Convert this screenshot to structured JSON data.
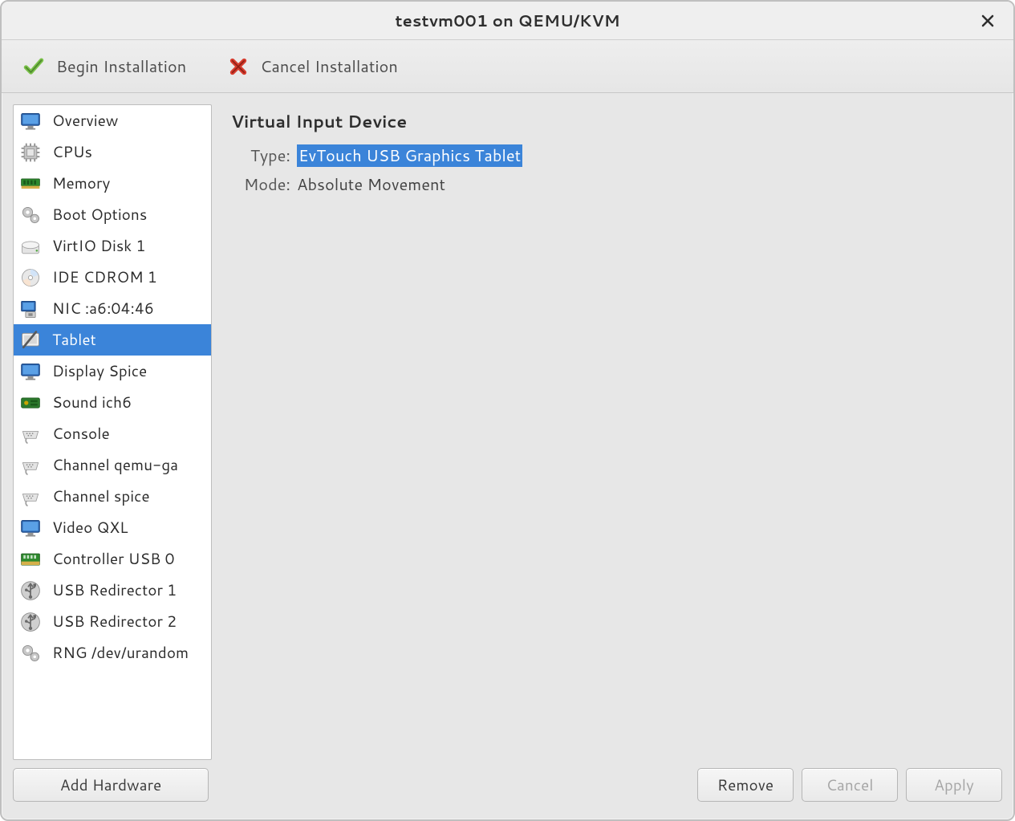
{
  "window": {
    "title": "testvm001 on QEMU/KVM"
  },
  "toolbar": {
    "begin_label": "Begin Installation",
    "cancel_label": "Cancel Installation"
  },
  "sidebar": {
    "items": [
      {
        "label": "Overview",
        "icon": "monitor-icon",
        "selected": false
      },
      {
        "label": "CPUs",
        "icon": "cpu-icon",
        "selected": false
      },
      {
        "label": "Memory",
        "icon": "memory-icon",
        "selected": false
      },
      {
        "label": "Boot Options",
        "icon": "gears-icon",
        "selected": false
      },
      {
        "label": "VirtIO Disk 1",
        "icon": "disk-icon",
        "selected": false
      },
      {
        "label": "IDE CDROM 1",
        "icon": "cdrom-icon",
        "selected": false
      },
      {
        "label": "NIC :a6:04:46",
        "icon": "nic-icon",
        "selected": false
      },
      {
        "label": "Tablet",
        "icon": "tablet-icon",
        "selected": true
      },
      {
        "label": "Display Spice",
        "icon": "monitor-icon",
        "selected": false
      },
      {
        "label": "Sound ich6",
        "icon": "sound-icon",
        "selected": false
      },
      {
        "label": "Console",
        "icon": "serial-icon",
        "selected": false
      },
      {
        "label": "Channel qemu-ga",
        "icon": "serial-icon",
        "selected": false
      },
      {
        "label": "Channel spice",
        "icon": "serial-icon",
        "selected": false
      },
      {
        "label": "Video QXL",
        "icon": "monitor-icon",
        "selected": false
      },
      {
        "label": "Controller USB 0",
        "icon": "controller-icon",
        "selected": false
      },
      {
        "label": "USB Redirector 1",
        "icon": "usb-icon",
        "selected": false
      },
      {
        "label": "USB Redirector 2",
        "icon": "usb-icon",
        "selected": false
      },
      {
        "label": "RNG /dev/urandom",
        "icon": "gears-icon",
        "selected": false
      }
    ]
  },
  "detail": {
    "heading": "Virtual Input Device",
    "type_label": "Type:",
    "type_value": "EvTouch USB Graphics Tablet",
    "mode_label": "Mode:",
    "mode_value": "Absolute Movement"
  },
  "buttons": {
    "add_hardware": "Add Hardware",
    "remove": "Remove",
    "cancel": "Cancel",
    "apply": "Apply"
  },
  "colors": {
    "selection": "#3b84d9",
    "accent_green": "#7bc24a",
    "accent_red": "#d63b2d"
  }
}
